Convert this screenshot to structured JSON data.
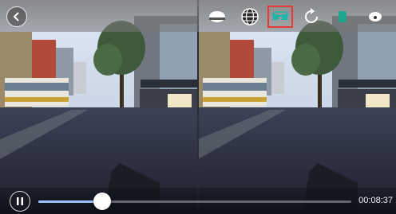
{
  "player": {
    "elapsed_time": "00:08:37",
    "progress": 0.205
  },
  "toolbar": {
    "items": [
      {
        "name": "headset-mode-icon"
      },
      {
        "name": "globe-projection-icon"
      },
      {
        "name": "vr-glasses-icon",
        "selected": true
      },
      {
        "name": "rotate-icon"
      },
      {
        "name": "gyro-icon"
      },
      {
        "name": "more-icon"
      }
    ]
  },
  "colors": {
    "selected_outline": "#e53935",
    "progress_fill": "#9ec3ff",
    "toolbar_bg": "#7a7a7a"
  }
}
